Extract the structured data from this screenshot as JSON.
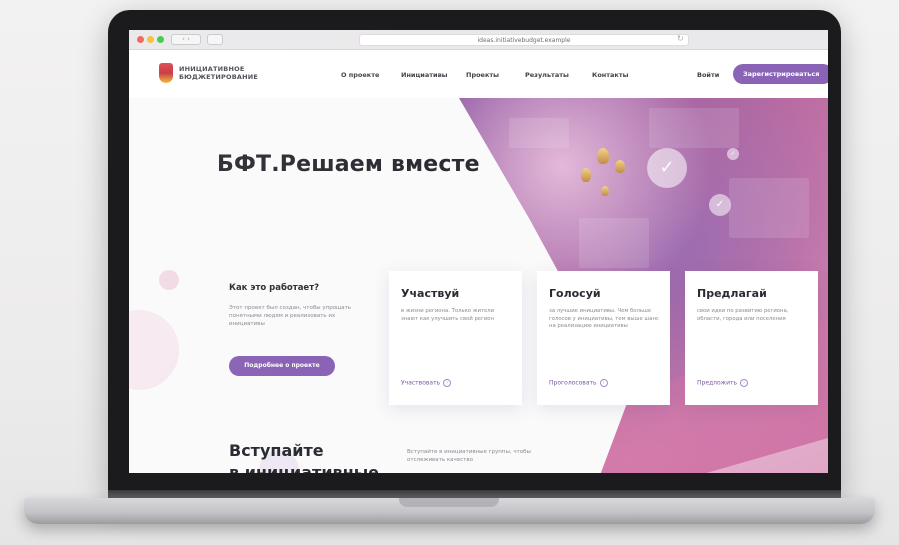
{
  "browser": {
    "url": "ideas.initiativebudget.example",
    "nav_arrows": "‹ ›",
    "reload_glyph": "↻"
  },
  "header": {
    "logo_line1": "ИНИЦИАТИВНОЕ",
    "logo_line2": "БЮДЖЕТИРОВАНИЕ",
    "nav": [
      "О проекте",
      "Инициативы",
      "Проекты",
      "Результаты",
      "Контакты"
    ],
    "login_label": "Войти",
    "register_label": "Зарегистрироваться"
  },
  "hero": {
    "title": "БФТ.Решаем вместе",
    "check_glyph": "✓"
  },
  "how_it_works": {
    "title": "Как это работает?",
    "text": "Этот проект был создан, чтобы упрощать понятными людям и реализовать их инициативы",
    "button_label": "Подробнее о проекте"
  },
  "cards": [
    {
      "title": "Участвуй",
      "text": "в жизни региона. Только жители знают как улучшить свой регион",
      "action": "Участвовать"
    },
    {
      "title": "Голосуй",
      "text": "за лучшие инициативы. Чем больше голосов у инициативы, тем выше шанс на реализацию инициативы",
      "action": "Проголосовать"
    },
    {
      "title": "Предлагай",
      "text": "свои идеи по развитию региона, области, города или поселения",
      "action": "Предложить"
    }
  ],
  "join": {
    "title": "Вступайте",
    "title_line2": "в инициативные",
    "text": "Вступайте в инициативные группы, чтобы отслеживать качество"
  },
  "colors": {
    "accent": "#8b63b6",
    "title": "#2b2b33"
  }
}
